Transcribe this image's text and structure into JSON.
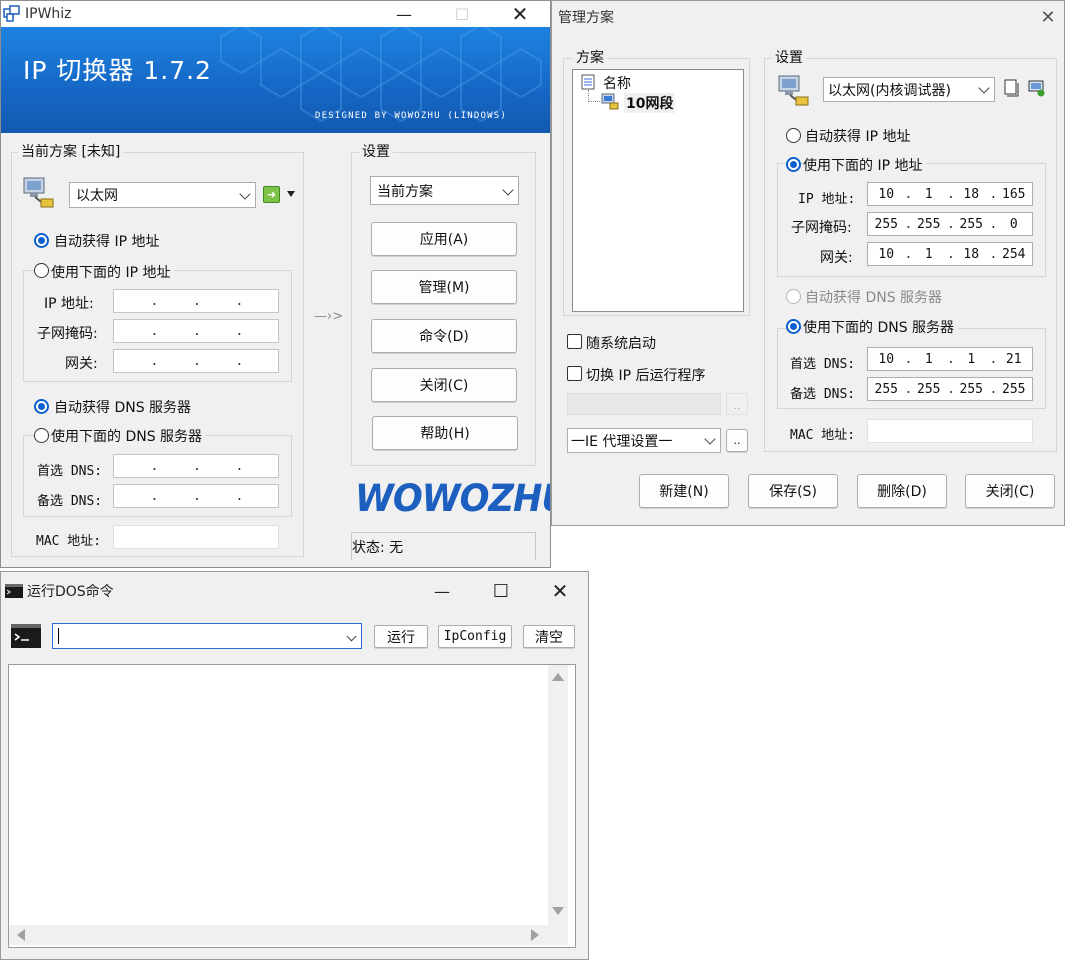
{
  "ipwhiz": {
    "title": "IPWhiz",
    "banner_title": "IP 切换器 1.7.2",
    "banner_sub": "DESIGNED BY WOWOZHU (LINDOWS)",
    "current_scheme_group": "当前方案 [未知]",
    "adapter": "以太网",
    "auto_ip": "自动获得 IP 地址",
    "use_ip": "使用下面的 IP 地址",
    "ip_label": "IP 地址:",
    "mask_label": "子网掩码:",
    "gw_label": "网关:",
    "auto_dns": "自动获得 DNS 服务器",
    "use_dns": "使用下面的 DNS 服务器",
    "dns1_label": "首选 DNS:",
    "dns2_label": "备选 DNS:",
    "mac_label": "MAC 地址:",
    "arrow": "—›>",
    "settings_group": "设置",
    "scheme_select": "当前方案",
    "btn_apply": "应用(A)",
    "btn_manage": "管理(M)",
    "btn_cmd": "命令(D)",
    "btn_close": "关闭(C)",
    "btn_help": "帮助(H)",
    "logo": "WOWOZHU",
    "status": "状态: 无"
  },
  "manager": {
    "title": "管理方案",
    "scheme_group": "方案",
    "tree_root": "名称",
    "tree_item": "10网段",
    "autostart": "随系统启动",
    "run_after": "切换 IP 后运行程序",
    "ie_proxy": "一IE 代理设置一",
    "dots": "..",
    "settings_group": "设置",
    "adapter": "以太网(内核调试器)",
    "auto_ip": "自动获得 IP 地址",
    "use_ip": "使用下面的 IP 地址",
    "ip_label": "IP 地址:",
    "mask_label": "子网掩码:",
    "gw_label": "网关:",
    "ip": [
      "10",
      "1",
      "18",
      "165"
    ],
    "mask": [
      "255",
      "255",
      "255",
      "0"
    ],
    "gw": [
      "10",
      "1",
      "18",
      "254"
    ],
    "auto_dns": "自动获得 DNS 服务器",
    "use_dns": "使用下面的 DNS 服务器",
    "dns1_label": "首选 DNS:",
    "dns2_label": "备选 DNS:",
    "dns1": [
      "10",
      "1",
      "1",
      "21"
    ],
    "dns2": [
      "255",
      "255",
      "255",
      "255"
    ],
    "mac_label": "MAC 地址:",
    "btn_new": "新建(N)",
    "btn_save": "保存(S)",
    "btn_delete": "删除(D)",
    "btn_close": "关闭(C)"
  },
  "dos": {
    "title": "运行DOS命令",
    "btn_run": "运行",
    "btn_ipconfig": "IpConfig",
    "btn_clear": "清空"
  },
  "colors": {
    "banner": "#1b73cf",
    "accent": "#0a5fd0",
    "logo": "#1c5fbf"
  }
}
